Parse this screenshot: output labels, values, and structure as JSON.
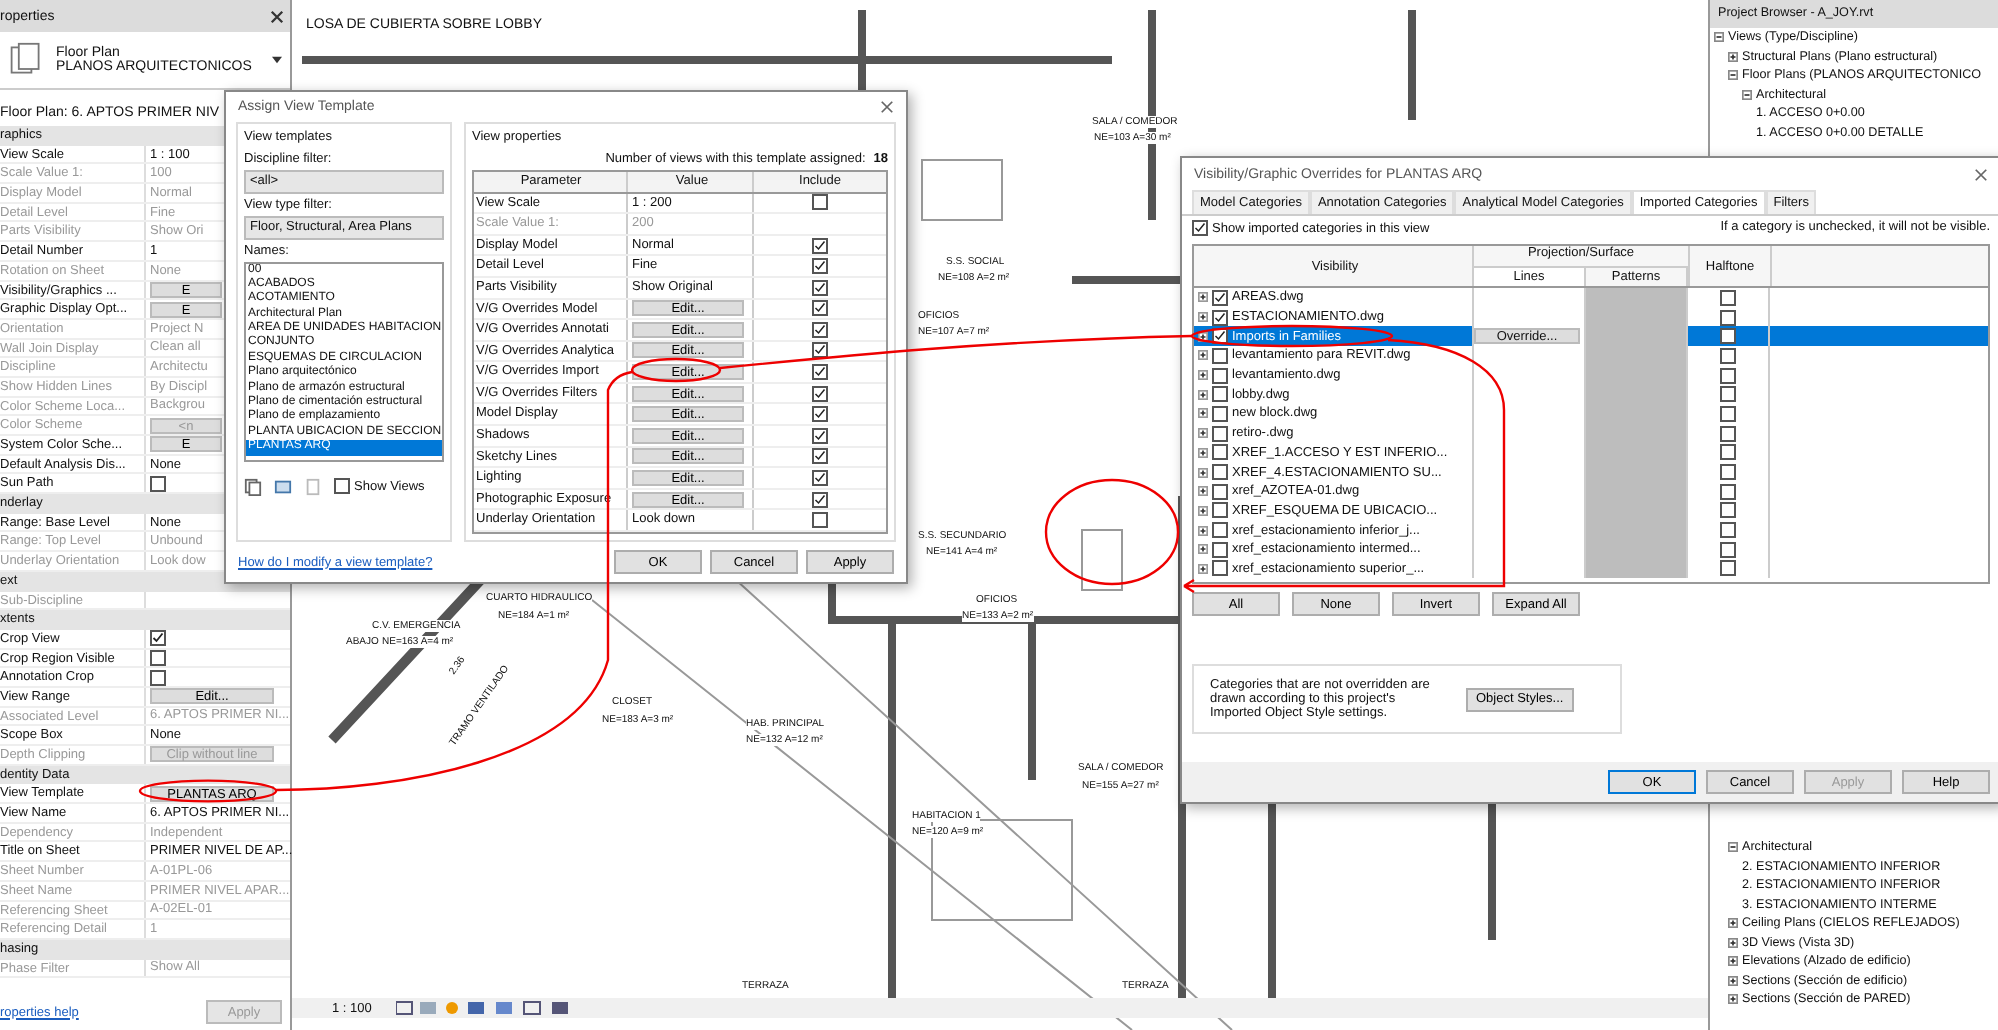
{
  "properties": {
    "title": "roperties",
    "type_family": "Floor Plan",
    "type_name": "PLANOS ARQUITECTONICOS",
    "instance": "Floor Plan: 6. APTOS PRIMER NIV",
    "rows": [
      {
        "kind": "group",
        "label": "raphics"
      },
      {
        "kind": "text",
        "label": "View Scale",
        "value": "1 : 100",
        "disabled": false
      },
      {
        "kind": "text",
        "label": "Scale Value    1:",
        "value": "100",
        "disabled": true
      },
      {
        "kind": "text",
        "label": "Display Model",
        "value": "Normal",
        "disabled": true
      },
      {
        "kind": "text",
        "label": "Detail Level",
        "value": "Fine",
        "disabled": true
      },
      {
        "kind": "text",
        "label": "Parts Visibility",
        "value": "Show Ori",
        "disabled": true
      },
      {
        "kind": "text",
        "label": "Detail Number",
        "value": "1",
        "disabled": false
      },
      {
        "kind": "text",
        "label": "Rotation on Sheet",
        "value": "None",
        "disabled": true
      },
      {
        "kind": "button",
        "label": "Visibility/Graphics ...",
        "value": "E",
        "disabled": false
      },
      {
        "kind": "button",
        "label": "Graphic Display Opt...",
        "value": "E",
        "disabled": false
      },
      {
        "kind": "text",
        "label": "Orientation",
        "value": "Project N",
        "disabled": true
      },
      {
        "kind": "text",
        "label": "Wall Join Display",
        "value": "Clean all",
        "disabled": true
      },
      {
        "kind": "text",
        "label": "Discipline",
        "value": "Architectu",
        "disabled": true
      },
      {
        "kind": "text",
        "label": "Show Hidden Lines",
        "value": "By Discipl",
        "disabled": true
      },
      {
        "kind": "text",
        "label": "Color Scheme Loca...",
        "value": "Backgrou",
        "disabled": true
      },
      {
        "kind": "button",
        "label": "Color Scheme",
        "value": "<n",
        "disabled": true
      },
      {
        "kind": "button",
        "label": "System Color Sche...",
        "value": "E",
        "disabled": false
      },
      {
        "kind": "text",
        "label": "Default Analysis Dis...",
        "value": "None",
        "disabled": false
      },
      {
        "kind": "check",
        "label": "Sun Path",
        "checked": false,
        "disabled": false
      },
      {
        "kind": "group",
        "label": "nderlay"
      },
      {
        "kind": "text",
        "label": "Range: Base Level",
        "value": "None",
        "disabled": false
      },
      {
        "kind": "text",
        "label": "Range: Top Level",
        "value": "Unbound",
        "disabled": true
      },
      {
        "kind": "text",
        "label": "Underlay Orientation",
        "value": "Look dow",
        "disabled": true
      },
      {
        "kind": "group",
        "label": "ext"
      },
      {
        "kind": "text",
        "label": "Sub-Discipline",
        "disabled": true
      },
      {
        "kind": "group",
        "label": "xtents"
      },
      {
        "kind": "check",
        "label": "Crop View",
        "checked": true,
        "disabled": false
      },
      {
        "kind": "check",
        "label": "Crop Region Visible",
        "checked": false,
        "disabled": false
      },
      {
        "kind": "check",
        "label": "Annotation Crop",
        "checked": false,
        "disabled": false
      },
      {
        "kind": "button",
        "label": "View Range",
        "value": "Edit...",
        "disabled": false
      },
      {
        "kind": "text",
        "label": "Associated Level",
        "value": "6. APTOS PRIMER NI...",
        "disabled": true
      },
      {
        "kind": "text",
        "label": "Scope Box",
        "value": "None",
        "disabled": false
      },
      {
        "kind": "button",
        "label": "Depth Clipping",
        "value": "Clip without line",
        "disabled": true
      },
      {
        "kind": "group",
        "label": "dentity Data"
      },
      {
        "kind": "button",
        "label": "View Template",
        "value": "PLANTAS ARQ",
        "disabled": false
      },
      {
        "kind": "text",
        "label": "View Name",
        "value": "6. APTOS PRIMER NI...",
        "disabled": false
      },
      {
        "kind": "text",
        "label": "Dependency",
        "value": "Independent",
        "disabled": true
      },
      {
        "kind": "text",
        "label": "Title on Sheet",
        "value": "PRIMER NIVEL DE AP...",
        "disabled": false
      },
      {
        "kind": "text",
        "label": "Sheet Number",
        "value": "A-01PL-06",
        "disabled": true
      },
      {
        "kind": "text",
        "label": "Sheet Name",
        "value": "PRIMER NIVEL APAR...",
        "disabled": true
      },
      {
        "kind": "text",
        "label": "Referencing Sheet",
        "value": "A-02EL-01",
        "disabled": true
      },
      {
        "kind": "text",
        "label": "Referencing Detail",
        "value": "1",
        "disabled": true
      },
      {
        "kind": "group",
        "label": "hasing"
      },
      {
        "kind": "text",
        "label": "Phase Filter",
        "value": "Show All",
        "disabled": true
      }
    ],
    "help_link": "roperties help",
    "apply": "Apply"
  },
  "canvas": {
    "title": "LOSA DE CUBIERTA SOBRE LOBBY",
    "labels": [
      "SALA / COMEDOR",
      "NE=103 A=30 m²",
      "S.S. SOCIAL",
      "NE=108 A=2 m²",
      "OFICIOS",
      "NE=107 A=7 m²",
      "S.S. SECUNDARIO",
      "NE=141 A=4 m²",
      "OFICIOS",
      "NE=133 A=2 m²",
      "CUARTO HIDRAULICO",
      "NE=184 A=1 m²",
      "C.V. EMERGENCIA",
      "ABAJO",
      "NE=163 A=4 m²",
      "CLOSET",
      "NE=183 A=3 m²",
      "HAB. PRINCIPAL",
      "NE=132 A=12 m²",
      "SALA / COMEDOR",
      "NE=155 A=27 m²",
      "HABITACION 1",
      "NE=120 A=9 m²",
      "TERRAZA",
      "TERRAZA",
      "2.36",
      "TRAMO VENTILADO"
    ],
    "scale": "1 : 100"
  },
  "assign_dialog": {
    "title": "Assign View Template",
    "templates_group": "View templates",
    "discipline_label": "Discipline filter:",
    "discipline_value": "<all>",
    "type_label": "View type filter:",
    "type_value": "Floor, Structural, Area Plans",
    "names_label": "Names:",
    "names": [
      {
        "label": "00",
        "selected": false
      },
      {
        "label": "ACABADOS",
        "selected": false
      },
      {
        "label": "ACOTAMIENTO",
        "selected": false
      },
      {
        "label": "Architectural Plan",
        "selected": false
      },
      {
        "label": "AREA DE UNIDADES HABITACION",
        "selected": false
      },
      {
        "label": "CONJUNTO",
        "selected": false
      },
      {
        "label": "ESQUEMAS DE CIRCULACION",
        "selected": false
      },
      {
        "label": "Plano arquitectónico",
        "selected": false
      },
      {
        "label": "Plano de armazón estructural",
        "selected": false
      },
      {
        "label": "Plano de cimentación estructural",
        "selected": false
      },
      {
        "label": "Plano de emplazamiento",
        "selected": false
      },
      {
        "label": "PLANTA UBICACION DE SECCION",
        "selected": false
      },
      {
        "label": "PLANTAS ARQ",
        "selected": true
      }
    ],
    "show_views": {
      "label": "Show Views",
      "checked": false
    },
    "help_link": "How do I modify a view template?",
    "properties_group": "View properties",
    "count_label": "Number of views with this template assigned:",
    "count": "18",
    "columns": [
      "Parameter",
      "Value",
      "Include"
    ],
    "rows": [
      {
        "parameter": "View Scale",
        "value": "1 : 200",
        "kind": "text",
        "disabled": false,
        "include": false
      },
      {
        "parameter": "Scale Value    1:",
        "value": "200",
        "kind": "text",
        "disabled": true
      },
      {
        "parameter": "Display Model",
        "value": "Normal",
        "kind": "text",
        "disabled": false,
        "include": true
      },
      {
        "parameter": "Detail Level",
        "value": "Fine",
        "kind": "text",
        "disabled": false,
        "include": true
      },
      {
        "parameter": "Parts Visibility",
        "value": "Show Original",
        "kind": "text",
        "disabled": false,
        "include": true
      },
      {
        "parameter": "V/G Overrides Model",
        "value": "Edit...",
        "kind": "button",
        "disabled": false,
        "include": true
      },
      {
        "parameter": "V/G Overrides Annotati",
        "value": "Edit...",
        "kind": "button",
        "disabled": false,
        "include": true
      },
      {
        "parameter": "V/G Overrides Analytica",
        "value": "Edit...",
        "kind": "button",
        "disabled": false,
        "include": true
      },
      {
        "parameter": "V/G Overrides Import",
        "value": "Edit...",
        "kind": "button",
        "disabled": false,
        "include": true
      },
      {
        "parameter": "V/G Overrides Filters",
        "value": "Edit...",
        "kind": "button",
        "disabled": false,
        "include": true
      },
      {
        "parameter": "Model Display",
        "value": "Edit...",
        "kind": "button",
        "disabled": false,
        "include": true
      },
      {
        "parameter": "Shadows",
        "value": "Edit...",
        "kind": "button",
        "disabled": false,
        "include": true
      },
      {
        "parameter": "Sketchy Lines",
        "value": "Edit...",
        "kind": "button",
        "disabled": false,
        "include": true
      },
      {
        "parameter": "Lighting",
        "value": "Edit...",
        "kind": "button",
        "disabled": false,
        "include": true
      },
      {
        "parameter": "Photographic Exposure",
        "value": "Edit...",
        "kind": "button",
        "disabled": false,
        "include": true
      },
      {
        "parameter": "Underlay Orientation",
        "value": "Look down",
        "kind": "text",
        "disabled": false,
        "include": false
      }
    ],
    "buttons": [
      "OK",
      "Cancel",
      "Apply"
    ]
  },
  "vg_dialog": {
    "title": "Visibility/Graphic Overrides for PLANTAS ARQ",
    "tabs": [
      {
        "label": "Model Categories",
        "selected": false
      },
      {
        "label": "Annotation Categories",
        "selected": false
      },
      {
        "label": "Analytical Model Categories",
        "selected": false
      },
      {
        "label": "Imported Categories",
        "selected": true
      },
      {
        "label": "Filters",
        "selected": false
      }
    ],
    "show_imported": {
      "label": "Show imported categories in this view",
      "checked": true
    },
    "note": "If a category is unchecked, it will not be visible.",
    "columns": {
      "visibility": "Visibility",
      "projection": "Projection/Surface",
      "lines": "Lines",
      "patterns": "Patterns",
      "halftone": "Halftone"
    },
    "rows": [
      {
        "name": "AREAS.dwg",
        "visible": true,
        "halftone": false,
        "selected": false
      },
      {
        "name": "ESTACIONAMIENTO.dwg",
        "visible": true,
        "halftone": false,
        "selected": false
      },
      {
        "name": "Imports in Families",
        "visible": true,
        "halftone": false,
        "selected": true,
        "override": "Override..."
      },
      {
        "name": "levantamiento para REVIT.dwg",
        "visible": false,
        "halftone": false,
        "selected": false
      },
      {
        "name": "levantamiento.dwg",
        "visible": false,
        "halftone": false,
        "selected": false
      },
      {
        "name": "lobby.dwg",
        "visible": false,
        "halftone": false,
        "selected": false
      },
      {
        "name": "new block.dwg",
        "visible": false,
        "halftone": false,
        "selected": false
      },
      {
        "name": "retiro-.dwg",
        "visible": false,
        "halftone": false,
        "selected": false
      },
      {
        "name": "XREF_1.ACCESO Y EST INFERIO...",
        "visible": false,
        "halftone": false,
        "selected": false
      },
      {
        "name": "XREF_4.ESTACIONAMIENTO SU...",
        "visible": false,
        "halftone": false,
        "selected": false
      },
      {
        "name": "xref_AZOTEA-01.dwg",
        "visible": false,
        "halftone": false,
        "selected": false
      },
      {
        "name": "XREF_ESQUEMA DE UBICACIO...",
        "visible": false,
        "halftone": false,
        "selected": false
      },
      {
        "name": "xref_estacionamiento inferior_j...",
        "visible": false,
        "halftone": false,
        "selected": false
      },
      {
        "name": "xref_estacionamiento intermed...",
        "visible": false,
        "halftone": false,
        "selected": false
      },
      {
        "name": "xref_estacionamiento superior_...",
        "visible": false,
        "halftone": false,
        "selected": false
      }
    ],
    "action_buttons": [
      "All",
      "None",
      "Invert",
      "Expand All"
    ],
    "info": "Categories that are not overridden are drawn according to this project's Imported Object Style settings.",
    "object_styles": "Object Styles...",
    "buttons": [
      {
        "label": "OK",
        "disabled": false
      },
      {
        "label": "Cancel",
        "disabled": false
      },
      {
        "label": "Apply",
        "disabled": true
      },
      {
        "label": "Help",
        "disabled": false
      }
    ]
  },
  "project_browser": {
    "title": "Project Browser - A_JOY.rvt",
    "tree": [
      {
        "label": "Views (Type/Discipline)",
        "expanded": true,
        "children": [
          {
            "label": "Structural Plans (Plano estructural)",
            "expanded": false
          },
          {
            "label": "Floor Plans (PLANOS ARQUITECTONICO",
            "expanded": true,
            "children": [
              {
                "label": "Architectural",
                "expanded": true,
                "children": [
                  {
                    "label": "1. ACCESO 0+0.00"
                  },
                  {
                    "label": "1. ACCESO 0+0.00 DETALLE"
                  }
                ]
              }
            ]
          }
        ]
      }
    ],
    "lower_tree": [
      {
        "children": [
          {
            "label": "Architectural",
            "expanded": true,
            "children": [
              {
                "label": "2. ESTACIONAMIENTO INFERIOR"
              },
              {
                "label": "2. ESTACIONAMIENTO INFERIOR"
              },
              {
                "label": "3. ESTACIONAMIENTO INTERME"
              }
            ]
          }
        ]
      },
      {
        "label": "Ceiling Plans (CIELOS REFLEJADOS)",
        "expanded": false
      },
      {
        "label": "3D Views (Vista 3D)",
        "expanded": false
      },
      {
        "label": "Elevations (Alzado de edificio)",
        "expanded": false
      },
      {
        "label": "Sections (Sección de edificio)",
        "expanded": false
      },
      {
        "label": "Sections (Sección de PARED)",
        "expanded": false
      }
    ]
  }
}
